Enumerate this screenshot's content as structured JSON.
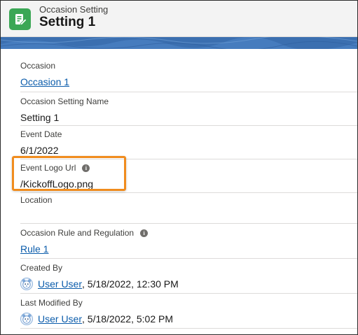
{
  "header": {
    "object_type": "Occasion Setting",
    "record_name": "Setting 1",
    "icon": "edit-document-icon",
    "icon_color": "#3ba755"
  },
  "fields": {
    "occasion": {
      "label": "Occasion",
      "value": "Occasion 1"
    },
    "setting_name": {
      "label": "Occasion Setting Name",
      "value": "Setting 1"
    },
    "event_date": {
      "label": "Event Date",
      "value": "6/1/2022"
    },
    "event_logo_url": {
      "label": "Event Logo Url",
      "value": "/KickoffLogo.png",
      "info_icon": "info-icon"
    },
    "location": {
      "label": "Location",
      "value": ""
    },
    "rule": {
      "label": "Occasion Rule and Regulation",
      "value": "Rule 1",
      "info_icon": "info-icon"
    },
    "created_by": {
      "label": "Created By",
      "user": "User User",
      "timestamp": ", 5/18/2022, 12:30 PM",
      "avatar": "user-avatar-icon"
    },
    "last_modified_by": {
      "label": "Last Modified By",
      "user": "User User",
      "timestamp": ", 5/18/2022, 5:02 PM",
      "avatar": "user-avatar-icon"
    }
  },
  "colors": {
    "link": "#0b5cab",
    "highlight": "#f08c1e",
    "banner": "#3b6fb0"
  }
}
